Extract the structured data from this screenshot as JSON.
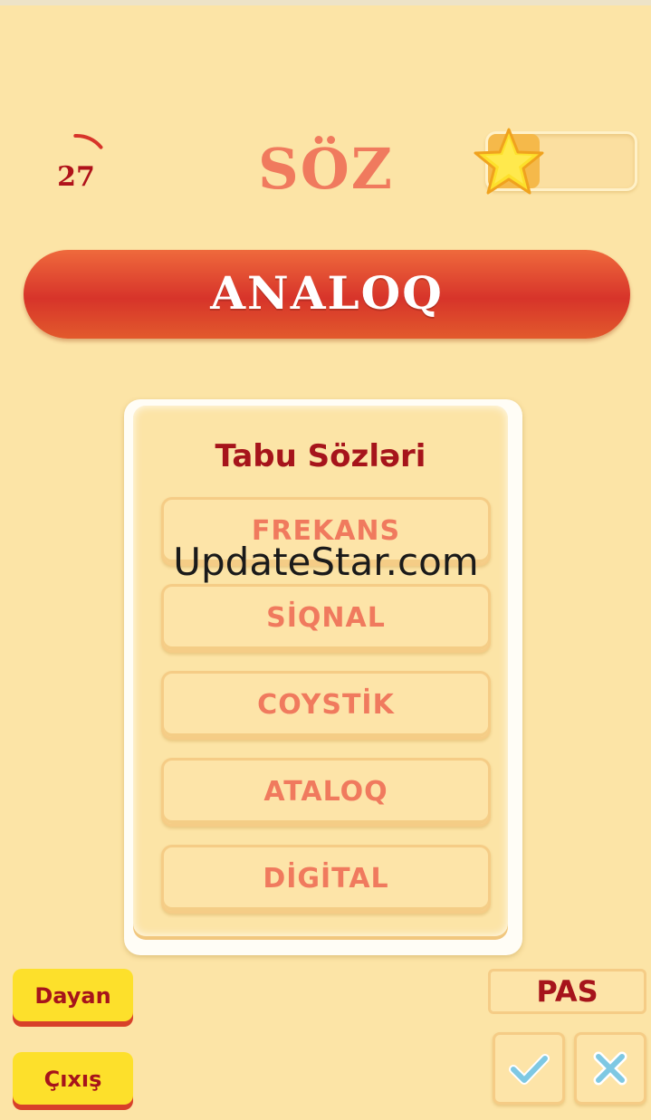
{
  "timer": {
    "value": "27",
    "fraction_remaining": 0.15
  },
  "header": {
    "title": "SÖZ"
  },
  "progress": {
    "fraction": 0.35
  },
  "word": "ANALOQ",
  "taboo_card": {
    "title": "Tabu Sözləri",
    "words": [
      "FREKANS",
      "SİQNAL",
      "COYSTİK",
      "ATALOQ",
      "DİGİTAL"
    ]
  },
  "watermark": "UpdateStar.com",
  "buttons": {
    "pause": "Dayan",
    "exit": "Çıxış",
    "pass": "PAS"
  },
  "icons": {
    "timer": "timer-ring-icon",
    "star": "star-icon",
    "correct": "check-icon",
    "wrong": "close-icon"
  },
  "colors": {
    "background": "#fce4a6",
    "accent_red": "#a6141b",
    "title_coral": "#f07a5e",
    "banner_red": "#d7342a",
    "button_yellow": "#fde02b",
    "check_blue": "#7ec8e3"
  }
}
